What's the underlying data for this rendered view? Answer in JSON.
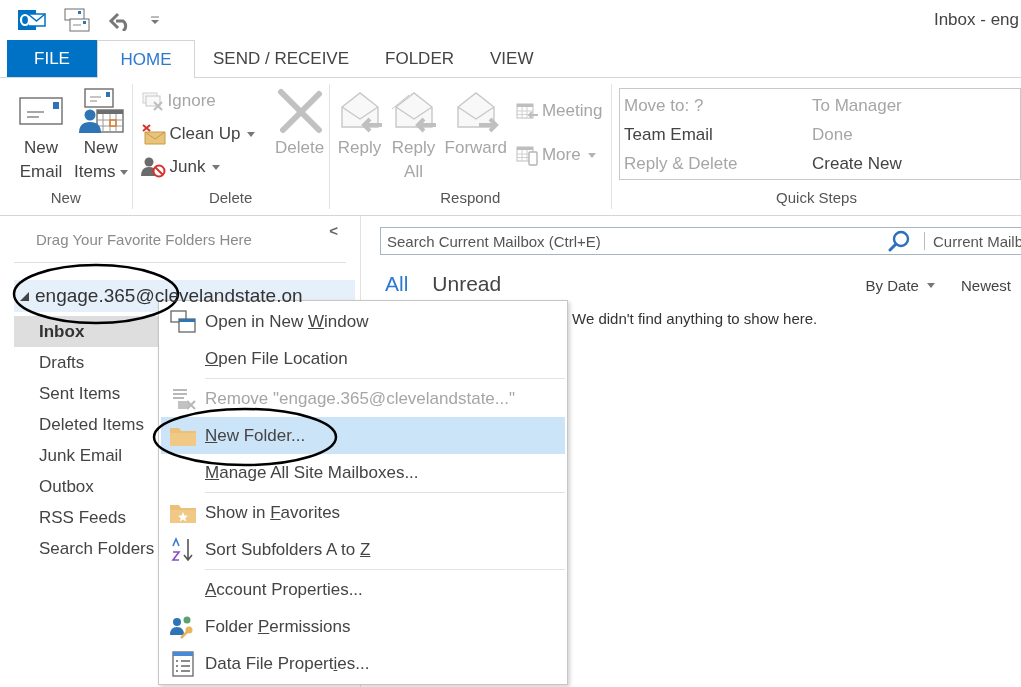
{
  "title_bar": {
    "title": "Inbox - eng"
  },
  "tabs": [
    {
      "label": "FILE",
      "kind": "file",
      "selected": false
    },
    {
      "label": "HOME",
      "kind": "tab",
      "selected": true
    },
    {
      "label": "SEND / RECEIVE",
      "kind": "tab",
      "selected": false
    },
    {
      "label": "FOLDER",
      "kind": "tab",
      "selected": false
    },
    {
      "label": "VIEW",
      "kind": "tab",
      "selected": false
    }
  ],
  "ribbon": {
    "groups": [
      {
        "label": "New",
        "items": [
          {
            "kind": "large",
            "lines": [
              "New",
              "Email"
            ],
            "dropdown": false,
            "disabled": false
          },
          {
            "kind": "large",
            "lines": [
              "New",
              "Items"
            ],
            "dropdown": true,
            "disabled": false
          }
        ]
      },
      {
        "label": "Delete",
        "items": [
          {
            "kind": "stack",
            "items": [
              {
                "label": "Ignore",
                "dropdown": false,
                "disabled": true
              },
              {
                "label": "Clean Up",
                "dropdown": true,
                "disabled": false
              },
              {
                "label": "Junk",
                "dropdown": true,
                "disabled": false
              }
            ]
          },
          {
            "kind": "large",
            "lines": [
              "Delete"
            ],
            "dropdown": false,
            "disabled": true
          }
        ]
      },
      {
        "label": "Respond",
        "items": [
          {
            "kind": "large",
            "lines": [
              "Reply"
            ],
            "dropdown": false,
            "disabled": true
          },
          {
            "kind": "large",
            "lines": [
              "Reply",
              "All"
            ],
            "dropdown": false,
            "disabled": true
          },
          {
            "kind": "large",
            "lines": [
              "Forward"
            ],
            "dropdown": false,
            "disabled": true
          },
          {
            "kind": "stack",
            "items": [
              {
                "label": "Meeting",
                "dropdown": false,
                "disabled": true
              },
              {
                "label": "More",
                "dropdown": true,
                "disabled": true
              }
            ]
          }
        ]
      },
      {
        "label": "Quick Steps",
        "items": [
          {
            "kind": "gallery",
            "columns": [
              [
                {
                  "label": "Move to: ?",
                  "disabled": true
                },
                {
                  "label": "Team Email",
                  "disabled": false
                },
                {
                  "label": "Reply & Delete",
                  "disabled": true
                }
              ],
              [
                {
                  "label": "To Manager",
                  "disabled": true
                },
                {
                  "label": "Done",
                  "disabled": true
                },
                {
                  "label": "Create New",
                  "disabled": false
                }
              ]
            ]
          }
        ]
      }
    ]
  },
  "navigation": {
    "favorites_hint": "Drag Your Favorite Folders Here",
    "collapse": "<",
    "account": {
      "label": "engage.365@clevelandstate.on",
      "expanded": true,
      "circled": true
    },
    "folders": [
      {
        "label": "Inbox",
        "selected": true
      },
      {
        "label": "Drafts",
        "selected": false
      },
      {
        "label": "Sent Items",
        "selected": false
      },
      {
        "label": "Deleted Items",
        "selected": false
      },
      {
        "label": "Junk Email",
        "selected": false
      },
      {
        "label": "Outbox",
        "selected": false
      },
      {
        "label": "RSS Feeds",
        "selected": false
      },
      {
        "label": "Search Folders",
        "selected": false
      }
    ]
  },
  "search": {
    "placeholder": "Search Current Mailbox (Ctrl+E)",
    "scope": "Current Mailb"
  },
  "filters": [
    {
      "label": "All",
      "selected": true
    },
    {
      "label": "Unread",
      "selected": false
    }
  ],
  "sort": {
    "by": "By Date",
    "order": "Newest"
  },
  "empty_message": "We didn't find anything to show here.",
  "context_menu": {
    "items": [
      {
        "kind": "item",
        "pre": "Open in New ",
        "key": "W",
        "post": "indow",
        "disabled": false,
        "highlighted": false,
        "circled": false
      },
      {
        "kind": "item",
        "key": "O",
        "post": "pen File Location",
        "disabled": false,
        "highlighted": false,
        "circled": false
      },
      {
        "kind": "separator"
      },
      {
        "kind": "item",
        "pre": "Remove \"engage.365@clevelandstate...\"",
        "disabled": true,
        "highlighted": false,
        "circled": false
      },
      {
        "kind": "item",
        "key": "N",
        "post": "ew Folder...",
        "disabled": false,
        "highlighted": true,
        "circled": true
      },
      {
        "kind": "item",
        "key": "M",
        "post": "anage All Site Mailboxes...",
        "disabled": false,
        "highlighted": false,
        "circled": false
      },
      {
        "kind": "separator"
      },
      {
        "kind": "item",
        "pre": "Show in ",
        "key": "F",
        "post": "avorites",
        "disabled": false,
        "highlighted": false,
        "circled": false
      },
      {
        "kind": "item",
        "pre": "Sort Subfolders A to ",
        "key": "Z",
        "disabled": false,
        "highlighted": false,
        "circled": false
      },
      {
        "kind": "separator"
      },
      {
        "kind": "item",
        "key": "A",
        "post": "ccount Properties...",
        "disabled": false,
        "highlighted": false,
        "circled": false
      },
      {
        "kind": "item",
        "pre": "Folder ",
        "key": "P",
        "post": "ermissions",
        "disabled": false,
        "highlighted": false,
        "circled": false
      },
      {
        "kind": "item",
        "pre": "Data File Propert",
        "key": "i",
        "post": "es...",
        "disabled": false,
        "highlighted": false,
        "circled": false
      }
    ]
  }
}
